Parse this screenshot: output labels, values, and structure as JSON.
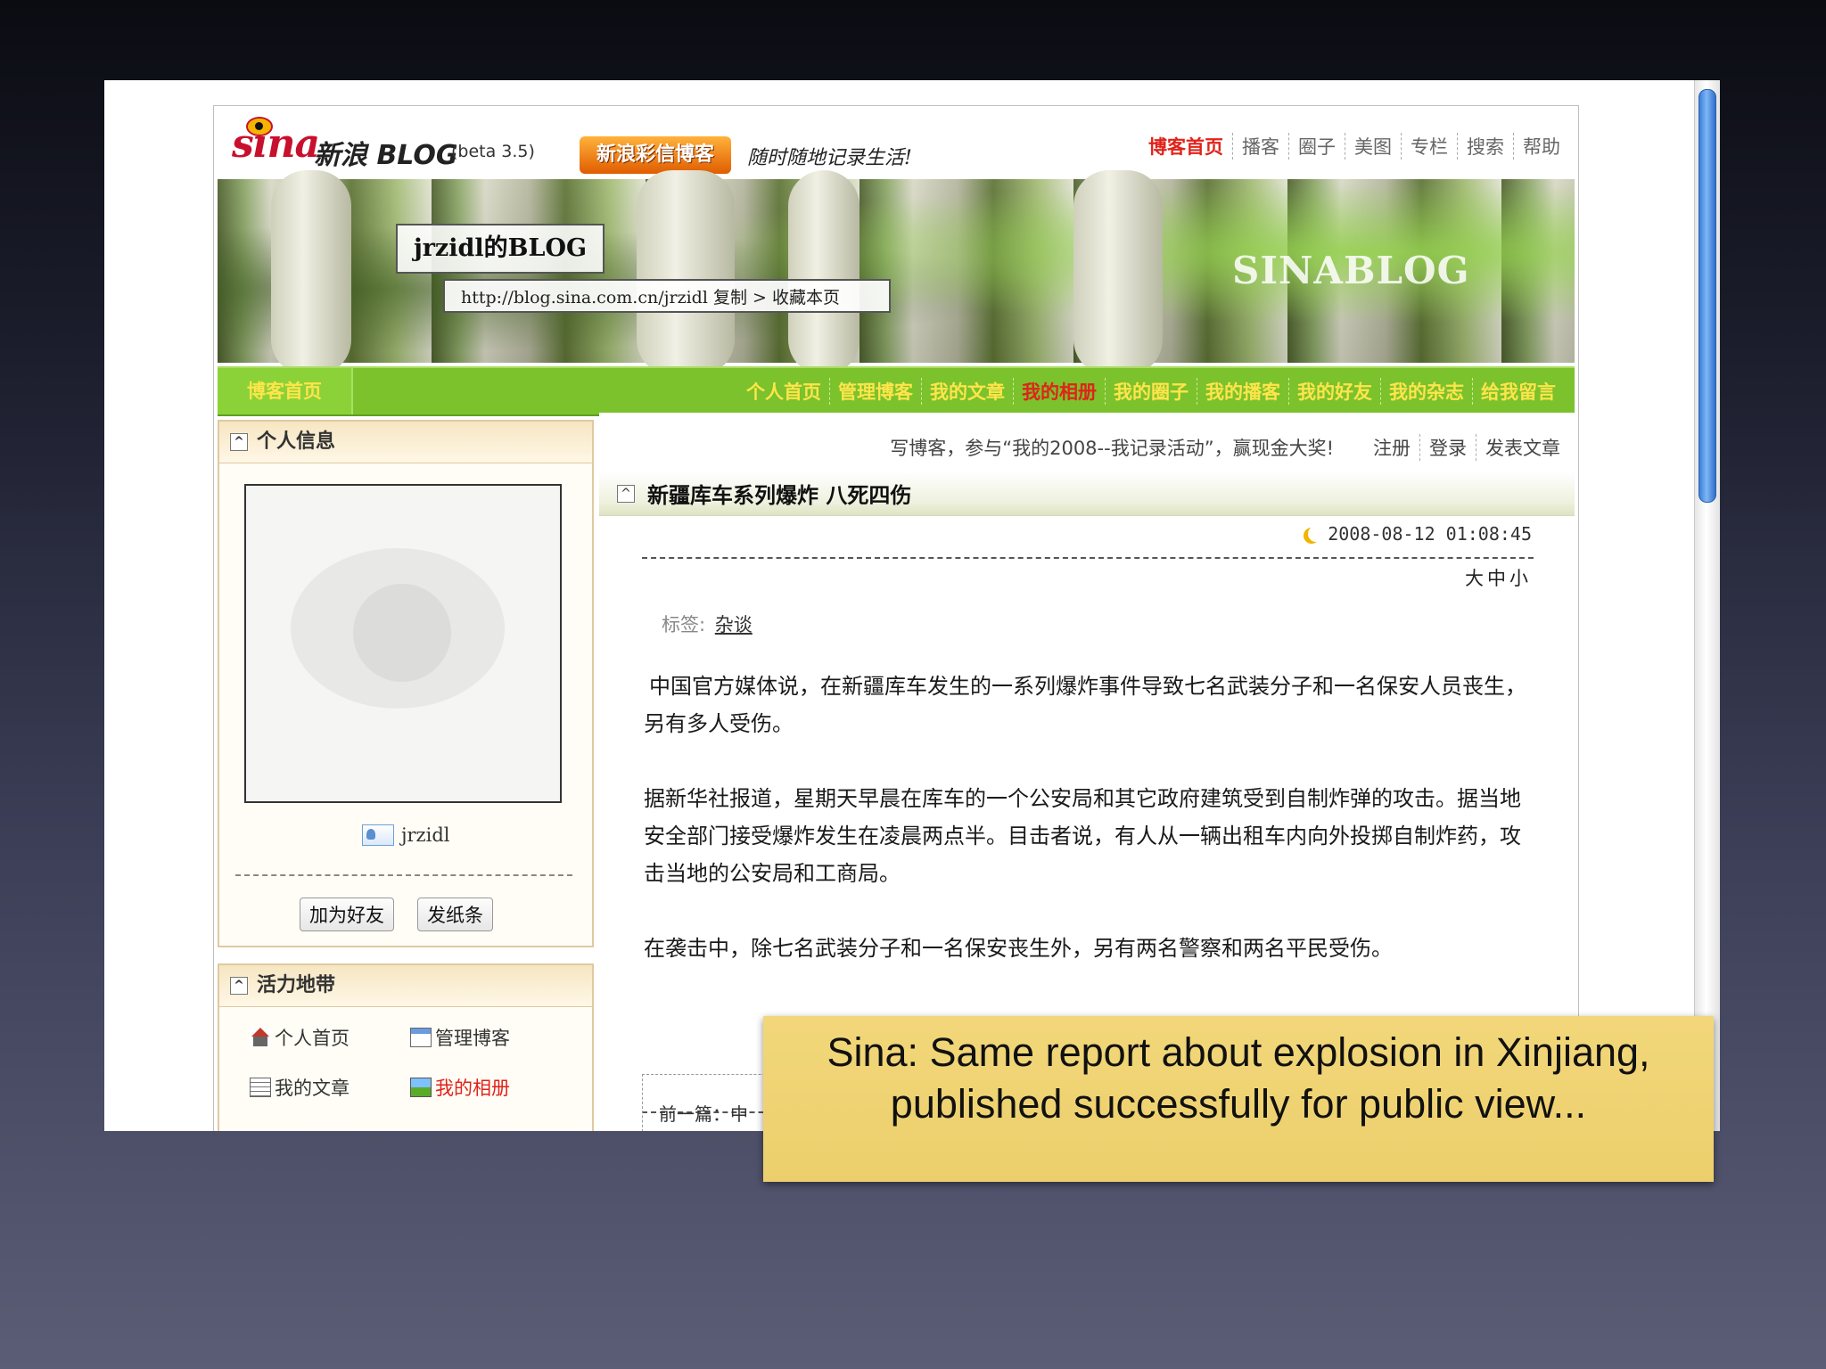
{
  "site": {
    "logo_text": "sina",
    "brand": "新浪 BLOG",
    "beta": "(beta 3.5)",
    "promo": "新浪彩信博客",
    "slogan": "随时随地记录生活!",
    "top_nav": [
      "博客首页",
      "播客",
      "圈子",
      "美图",
      "专栏",
      "搜索",
      "帮助"
    ]
  },
  "banner": {
    "blog_title": "jrzidl的BLOG",
    "url": "http://blog.sina.com.cn/jrzidl",
    "copy_label": "复制",
    "bookmark_label": "> 收藏本页",
    "watermark": "SINABLOG"
  },
  "green_nav": {
    "home": "博客首页",
    "items": [
      "个人首页",
      "管理博客",
      "我的文章",
      "我的相册",
      "我的圈子",
      "我的播客",
      "我的好友",
      "我的杂志",
      "给我留言"
    ],
    "active_index": 3
  },
  "profile_box": {
    "title": "个人信息",
    "username": "jrzidl",
    "add_friend": "加为好友",
    "send_note": "发纸条"
  },
  "links_box": {
    "title": "活力地带",
    "links": [
      {
        "label": "个人首页",
        "icon": "house-icon"
      },
      {
        "label": "管理博客",
        "icon": "dashboard-icon"
      },
      {
        "label": "我的文章",
        "icon": "document-icon"
      },
      {
        "label": "我的相册",
        "icon": "photo-icon"
      }
    ]
  },
  "notice": {
    "message": "写博客，参与“我的2008--我记录活动”，赢现金大奖!",
    "links": [
      "注册",
      "登录",
      "发表文章"
    ]
  },
  "article": {
    "title": "新疆库车系列爆炸 八死四伤",
    "date": "2008-08-12 01:08:45",
    "font_size_controls": "大中小",
    "tags_label": "标签:",
    "tag": "杂谈",
    "paragraphs": [
      "中国官方媒体说，在新疆库车发生的一系列爆炸事件导致七名武装分子和一名保安人员丧生，另有多人受伤。",
      "据新华社报道，星期天早晨在库车的一个公安局和其它政府建筑受到自制炸弹的攻击。据当地安全部门接受爆炸发生在凌晨两点半。目击者说，有人从一辆出租车内向外投掷自制炸药，攻击当地的公安局和工商局。",
      "在袭击中，除七名武装分子和一名保安丧生外，另有两名警察和两名平民受伤。"
    ],
    "prev_label": "前一篇：中"
  },
  "caption": {
    "line1": "Sina: Same report about explosion in Xinjiang,",
    "line2": "published successfully for public view..."
  },
  "colors": {
    "accent_red": "#e0231a",
    "nav_green": "#7bc22c",
    "nav_text_yellow": "#ffe54a",
    "caption_yellow": "#eccf6c"
  }
}
